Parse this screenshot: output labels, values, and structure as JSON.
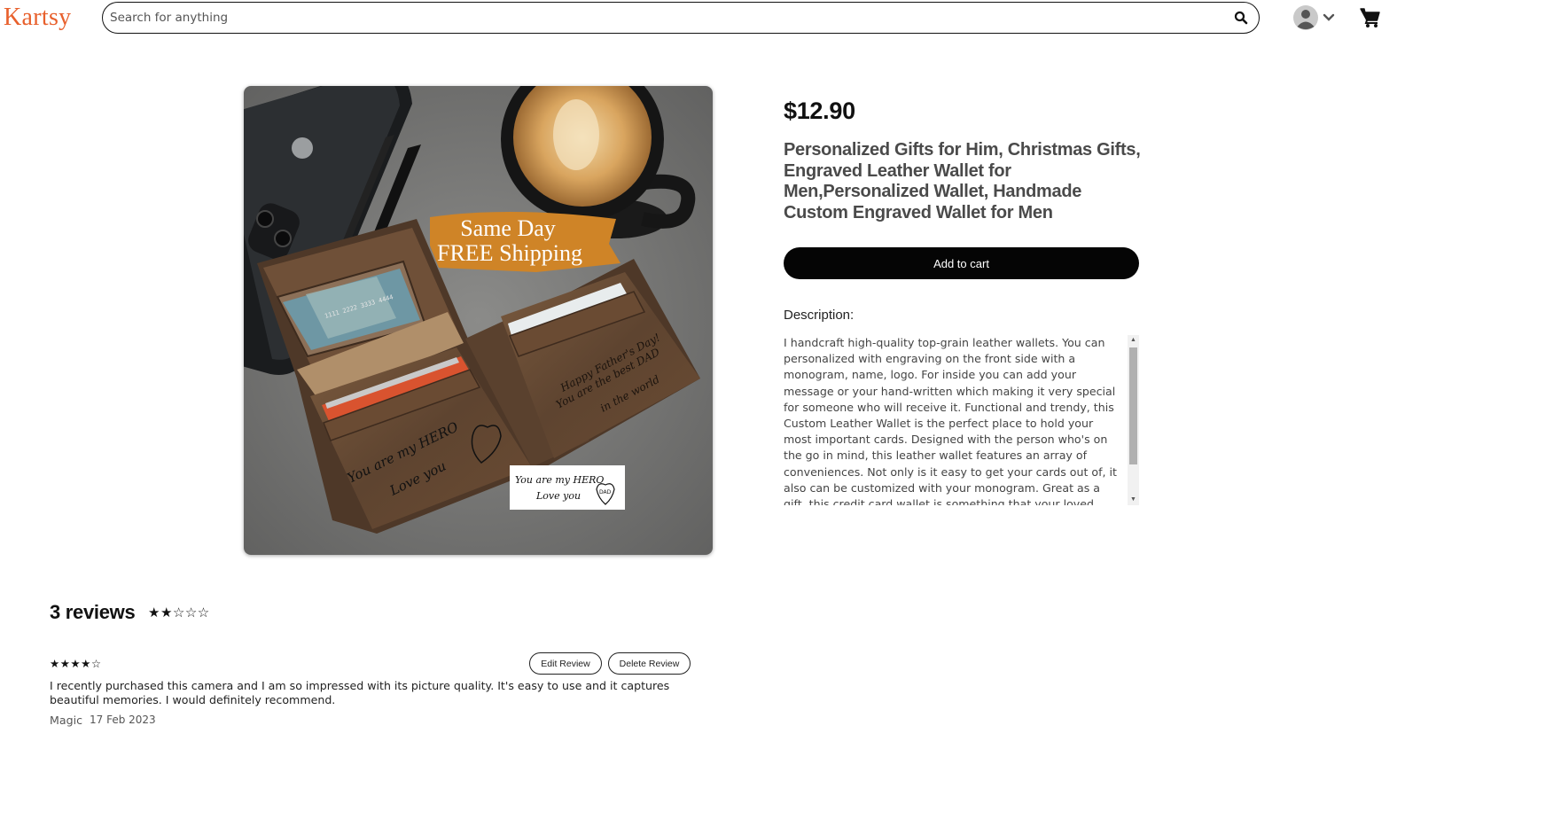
{
  "header": {
    "logo": "Kartsy",
    "search_placeholder": "Search for anything",
    "search_value": "",
    "icons": {
      "search": "search-icon",
      "user": "user-avatar-icon",
      "dropdown": "chevron-down-icon",
      "cart": "cart-icon"
    }
  },
  "product": {
    "price": "$12.90",
    "title": "Personalized Gifts for Him, Christmas Gifts, Engraved Leather Wallet for Men,Personalized Wallet, Handmade Custom Engraved Wallet for Men",
    "add_to_cart": "Add to cart",
    "description_label": "Description:",
    "description": "I handcraft high-quality top-grain leather wallets. You can personalized with engraving on the front side with a monogram, name, logo. For inside you can add your message or your hand-written which making it very special for someone who will receive it. Functional and trendy, this Custom Leather Wallet is the perfect place to hold your most important cards. Designed with the person who's on the go in mind, this leather wallet features an array of conveniences. Not only is it easy to get your cards out of, it also can be customized with your monogram. Great as a gift, this credit card wallet is something that your loved ones will appreciate as a trendy and functional holiday",
    "image": {
      "banner_line1": "Same Day",
      "banner_line2": "FREE Shipping",
      "engraving_right_1": "Happy Father's Day!",
      "engraving_right_2": "You are the best DAD",
      "engraving_right_3": "in the world",
      "engraving_left_1": "You are my HERO",
      "engraving_left_2": "Love you",
      "engraving_heart": "DAD",
      "card_number": "1111 2222 3333 4444"
    }
  },
  "reviews": {
    "count_label": "3 reviews",
    "average_stars": "★★☆☆☆",
    "average_rating": 2,
    "items": [
      {
        "stars": "★★★★☆",
        "rating": 4,
        "edit_label": "Edit Review",
        "delete_label": "Delete Review",
        "text": "I recently purchased this camera and I am so impressed with its picture quality. It's easy to use and it captures beautiful memories. I would definitely recommend.",
        "author": "Magic",
        "date": "17 Feb 2023"
      }
    ]
  },
  "colors": {
    "logo": "#e8602c",
    "button": "#050505",
    "banner": "#d98a2b"
  }
}
